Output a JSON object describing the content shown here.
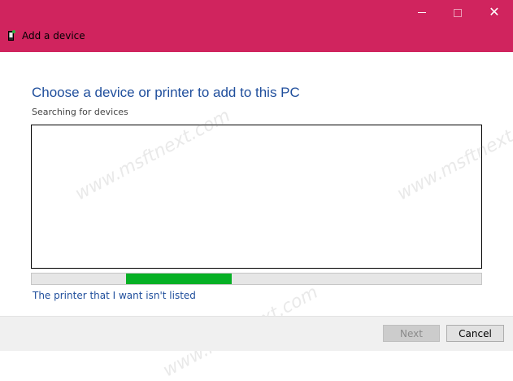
{
  "window": {
    "title": "Add a device",
    "accent_color": "#d0245e",
    "controls": {
      "minimize_icon": "minimize-icon",
      "maximize_icon": "maximize-icon",
      "close_icon": "close-icon",
      "close_glyph": "✕"
    }
  },
  "main": {
    "heading": "Choose a device or printer to add to this PC",
    "status": "Searching for devices",
    "device_list": [],
    "progress": {
      "indeterminate": true,
      "segment_start_fraction": 0.21,
      "segment_end_fraction": 0.445,
      "color": "#06b025"
    },
    "link_text": "The printer that I want isn't listed"
  },
  "footer": {
    "next_label": "Next",
    "next_enabled": false,
    "cancel_label": "Cancel"
  },
  "watermark": {
    "text": "www.msftnext.com"
  }
}
